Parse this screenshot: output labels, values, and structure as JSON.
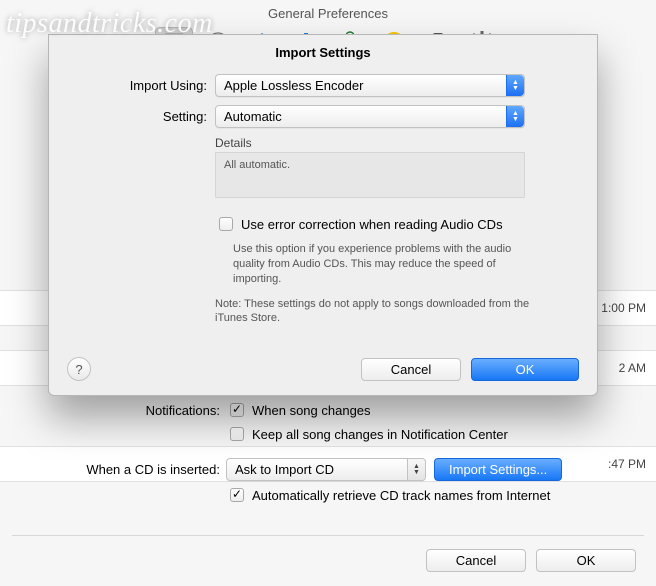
{
  "watermark": "tipsandtricks.com",
  "background": {
    "title": "General Preferences",
    "rows": [
      "1:00 PM",
      "2 AM",
      ":47 PM"
    ],
    "notifications_label": "Notifications:",
    "notif_song_changes": "When song changes",
    "notif_keep_all": "Keep all song changes in Notification Center",
    "cd_label": "When a CD is inserted:",
    "cd_select_value": "Ask to Import CD",
    "import_settings_btn": "Import Settings...",
    "auto_retrieve": "Automatically retrieve CD track names from Internet",
    "cancel": "Cancel",
    "ok": "OK"
  },
  "sheet": {
    "title": "Import Settings",
    "import_using_label": "Import Using:",
    "import_using_value": "Apple Lossless Encoder",
    "setting_label": "Setting:",
    "setting_value": "Automatic",
    "details_label": "Details",
    "details_text": "All automatic.",
    "error_correction": "Use error correction when reading Audio CDs",
    "error_hint": "Use this option if you experience problems with the audio quality from Audio CDs.  This may reduce the speed of importing.",
    "note": "Note: These settings do not apply to songs downloaded from the iTunes Store.",
    "help": "?",
    "cancel": "Cancel",
    "ok": "OK"
  }
}
